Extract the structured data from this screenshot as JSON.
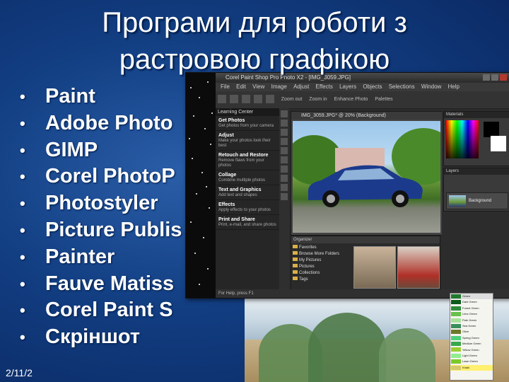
{
  "slide": {
    "title_line1": "Програми для роботи з",
    "title_line2": "растровою графікою",
    "bullets": [
      "Paint",
      "Adobe Photo",
      "GIMP",
      "Corel PhotoP",
      "Photostyler",
      "Picture Publis",
      "Painter",
      "Fauve Matiss",
      "Corel Paint S",
      "Скріншот"
    ],
    "date": "2/11/2"
  },
  "screenshot": {
    "window_title": "Corel Paint Shop Pro Photo X2 - [IMG_3059.JPG]",
    "menu": [
      "File",
      "Edit",
      "View",
      "Image",
      "Adjust",
      "Effects",
      "Layers",
      "Objects",
      "Selections",
      "Window",
      "Help"
    ],
    "toolbar": [
      "Zoom out",
      "Zoom in",
      "Enhance Photo",
      "Palettes"
    ],
    "learning_center": {
      "header": "Learning Center",
      "items": [
        {
          "title": "Get Photos",
          "desc": "Get photos from your camera"
        },
        {
          "title": "Adjust",
          "desc": "Make your photos look their best"
        },
        {
          "title": "Retouch and Restore",
          "desc": "Remove flaws from your photos"
        },
        {
          "title": "Collage",
          "desc": "Combine multiple photos"
        },
        {
          "title": "Text and Graphics",
          "desc": "Add text and shapes"
        },
        {
          "title": "Effects",
          "desc": "Apply effects to your photos"
        },
        {
          "title": "Print and Share",
          "desc": "Print, e-mail, and share photos"
        }
      ]
    },
    "document_title": "IMG_3059.JPG* @ 20% (Background)",
    "organizer": {
      "toolbar": "Organizer",
      "folders": [
        "Favorites",
        "Browse More Folders",
        "My Pictures",
        "Pictures",
        "Collections",
        "Tags"
      ]
    },
    "palettes": {
      "materials": "Materials",
      "layers": "Layers",
      "layer_name": "Background"
    },
    "status": "For Help, press F1",
    "accent_colors": {
      "window_bg": "#2b2b2b",
      "car": "#1c3a8c",
      "slide_bg": "#123e82"
    }
  },
  "color_list": {
    "rows": [
      {
        "label": "Green",
        "color": "#1f7a2e"
      },
      {
        "label": "Dark Green",
        "color": "#0e5a1c"
      },
      {
        "label": "Forest Green",
        "color": "#2e8b3a"
      },
      {
        "label": "Lime Green",
        "color": "#66c24a"
      },
      {
        "label": "Pale Green",
        "color": "#a8e29a"
      },
      {
        "label": "Sea Green",
        "color": "#3a8f5c"
      },
      {
        "label": "Olive",
        "color": "#6b7a2a"
      },
      {
        "label": "Spring Green",
        "color": "#4fd07a"
      },
      {
        "label": "Medium Green",
        "color": "#38a84a"
      },
      {
        "label": "Yellow Green",
        "color": "#9acd32"
      },
      {
        "label": "Light Green",
        "color": "#90ee90"
      },
      {
        "label": "Lawn Green",
        "color": "#7cca2a"
      },
      {
        "label": "Khaki",
        "color": "#d4c870"
      }
    ]
  }
}
